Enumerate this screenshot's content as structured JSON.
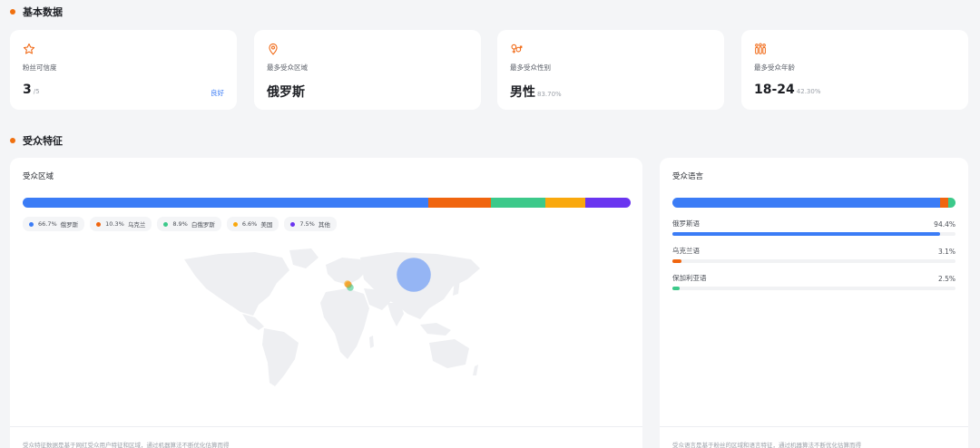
{
  "sections": {
    "basic": "基本数据",
    "audience": "受众特征"
  },
  "stats": [
    {
      "icon": "star-icon",
      "label": "粉丝可信度",
      "value": "3",
      "sub": "/5",
      "tag": "良好"
    },
    {
      "icon": "location-pin-icon",
      "label": "最多受众区域",
      "value": "俄罗斯",
      "sub": "",
      "tag": ""
    },
    {
      "icon": "gender-icon",
      "label": "最多受众性别",
      "value": "男性",
      "sub": "83.70%",
      "tag": ""
    },
    {
      "icon": "people-icon",
      "label": "最多受众年龄",
      "value": "18-24",
      "sub": "42.30%",
      "tag": ""
    }
  ],
  "region_panel": {
    "title": "受众区域",
    "footer": "受众特征数据是基于网红受众用户特征和区域，通过机器算法不断优化估算而得",
    "segments": [
      {
        "pct": "66.7%",
        "value": 66.7,
        "name": "俄罗斯",
        "color": "#3b7cf6"
      },
      {
        "pct": "10.3%",
        "value": 10.3,
        "name": "乌克兰",
        "color": "#f0650f"
      },
      {
        "pct": "8.9%",
        "value": 8.9,
        "name": "白俄罗斯",
        "color": "#3cc98a"
      },
      {
        "pct": "6.6%",
        "value": 6.6,
        "name": "美国",
        "color": "#f9a80d"
      },
      {
        "pct": "7.5%",
        "value": 7.5,
        "name": "其他",
        "color": "#6a35f0"
      }
    ]
  },
  "language_panel": {
    "title": "受众语言",
    "footer": "受众语言是基于粉丝的区域和语言特征，通过机器算法不断优化估算而得",
    "languages": [
      {
        "name": "俄罗斯语",
        "pct": "94.4%",
        "value": 94.4,
        "color": "#3b7cf6"
      },
      {
        "name": "乌克兰语",
        "pct": "3.1%",
        "value": 3.1,
        "color": "#f0650f"
      },
      {
        "name": "保加利亚语",
        "pct": "2.5%",
        "value": 2.5,
        "color": "#3cc98a"
      }
    ]
  }
}
